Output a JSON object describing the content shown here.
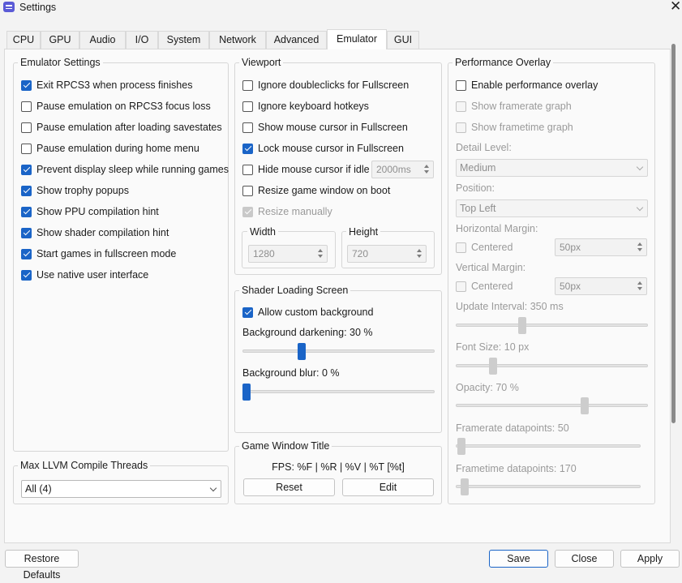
{
  "window": {
    "title": "Settings"
  },
  "tabs": [
    {
      "label": "CPU"
    },
    {
      "label": "GPU"
    },
    {
      "label": "Audio"
    },
    {
      "label": "I/O"
    },
    {
      "label": "System"
    },
    {
      "label": "Network"
    },
    {
      "label": "Advanced"
    },
    {
      "label": "Emulator"
    },
    {
      "label": "GUI"
    }
  ],
  "active_tab": "Emulator",
  "emulator_settings": {
    "title": "Emulator Settings",
    "options": [
      {
        "label": "Exit RPCS3 when process finishes",
        "checked": true
      },
      {
        "label": "Pause emulation on RPCS3 focus loss",
        "checked": false
      },
      {
        "label": "Pause emulation after loading savestates",
        "checked": false
      },
      {
        "label": "Pause emulation during home menu",
        "checked": false
      },
      {
        "label": "Prevent display sleep while running games",
        "checked": true
      },
      {
        "label": "Show trophy popups",
        "checked": true
      },
      {
        "label": "Show PPU compilation hint",
        "checked": true
      },
      {
        "label": "Show shader compilation hint",
        "checked": true
      },
      {
        "label": "Start games in fullscreen mode",
        "checked": true
      },
      {
        "label": "Use native user interface",
        "checked": true
      }
    ]
  },
  "llvm_threads": {
    "title": "Max LLVM Compile Threads",
    "value": "All (4)"
  },
  "viewport": {
    "title": "Viewport",
    "options": [
      {
        "label": "Ignore doubleclicks for Fullscreen",
        "checked": false
      },
      {
        "label": "Ignore keyboard hotkeys",
        "checked": false
      },
      {
        "label": "Show mouse cursor in Fullscreen",
        "checked": false
      },
      {
        "label": "Lock mouse cursor in Fullscreen",
        "checked": true
      },
      {
        "label": "Hide mouse cursor if idle",
        "checked": false
      },
      {
        "label": "Resize game window on boot",
        "checked": false
      },
      {
        "label": "Resize manually",
        "checked": true,
        "disabled": true
      }
    ],
    "idle_time": "2000ms",
    "width_label": "Width",
    "width_value": "1280",
    "height_label": "Height",
    "height_value": "720"
  },
  "shader_loading": {
    "title": "Shader Loading Screen",
    "allow_custom_bg": {
      "label": "Allow custom background",
      "checked": true
    },
    "darkening_label": "Background darkening: 30 %",
    "darkening_value": 30,
    "blur_label": "Background blur: 0 %",
    "blur_value": 0
  },
  "game_window_title": {
    "title": "Game Window Title",
    "format": "FPS: %F | %R | %V | %T [%t]",
    "reset_label": "Reset",
    "edit_label": "Edit"
  },
  "performance_overlay": {
    "title": "Performance Overlay",
    "enable": {
      "label": "Enable performance overlay",
      "checked": false
    },
    "framerate_graph": {
      "label": "Show framerate graph",
      "checked": false
    },
    "frametime_graph": {
      "label": "Show frametime graph",
      "checked": false
    },
    "detail_level_label": "Detail Level:",
    "detail_level_value": "Medium",
    "position_label": "Position:",
    "position_value": "Top Left",
    "h_margin_label": "Horizontal Margin:",
    "h_centered": {
      "label": "Centered",
      "checked": false
    },
    "h_margin_value": "50px",
    "v_margin_label": "Vertical Margin:",
    "v_centered": {
      "label": "Centered",
      "checked": false
    },
    "v_margin_value": "50px",
    "update_interval_label": "Update Interval: 350 ms",
    "update_interval_fraction": 0.34,
    "font_size_label": "Font Size: 10 px",
    "font_size_fraction": 0.18,
    "opacity_label": "Opacity: 70 %",
    "opacity_fraction": 0.68,
    "framerate_points_label": "Framerate datapoints: 50",
    "framerate_points_fraction": 0.0,
    "frametime_points_label": "Frametime datapoints: 170",
    "frametime_points_fraction": 0.02
  },
  "footer": {
    "restore_label": "Restore Defaults",
    "save_label": "Save",
    "close_label": "Close",
    "apply_label": "Apply"
  }
}
